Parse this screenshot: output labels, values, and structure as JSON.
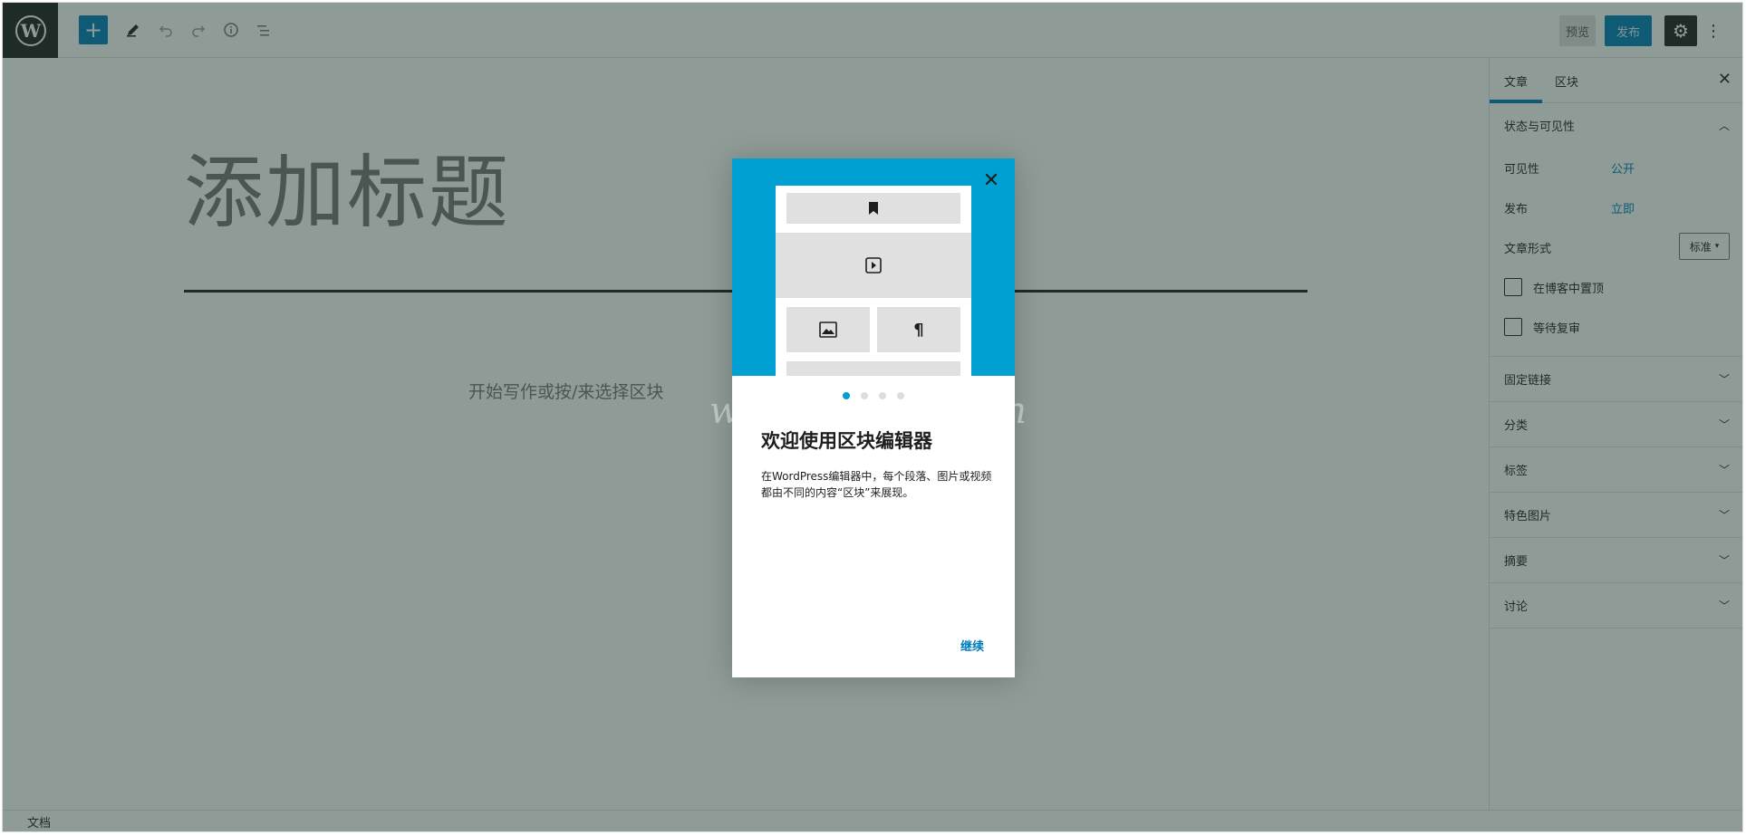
{
  "toolbar": {
    "logo_icon": "wordpress-logo",
    "add_icon": "plus-icon",
    "tools_icon": "pencil-icon",
    "undo_icon": "undo-icon",
    "redo_icon": "redo-icon",
    "info_icon": "info-icon",
    "outline_icon": "list-view-icon",
    "preview_label": "预览",
    "publish_label": "发布",
    "settings_icon": "gear-icon",
    "more_icon": "more-vertical-icon"
  },
  "editor": {
    "title_placeholder": "添加标题",
    "block_placeholder": "开始写作或按/来选择区块"
  },
  "sidebar": {
    "tabs": [
      {
        "label": "文章",
        "active": true
      },
      {
        "label": "区块",
        "active": false
      }
    ],
    "close_icon": "close-icon",
    "status_panel": {
      "title": "状态与可见性",
      "visibility_label": "可见性",
      "visibility_value": "公开",
      "publish_label": "发布",
      "publish_value": "立即",
      "format_label": "文章形式",
      "format_value": "标准",
      "sticky_label": "在博客中置顶",
      "pending_label": "等待复审"
    },
    "panels": [
      {
        "title": "固定链接"
      },
      {
        "title": "分类"
      },
      {
        "title": "标签"
      },
      {
        "title": "特色图片"
      },
      {
        "title": "摘要"
      },
      {
        "title": "讨论"
      }
    ]
  },
  "footer": {
    "breadcrumb": "文档"
  },
  "modal": {
    "heading": "欢迎使用区块编辑器",
    "body": "在WordPress编辑器中，每个段落、图片或视频都由不同的内容“区块”来展现。",
    "continue_label": "继续",
    "page_count": 4,
    "current_page": 1,
    "hero_color": "#00a0d2"
  },
  "watermark": "www.fenonlg.cn",
  "colors": {
    "accent": "#007cba",
    "dark": "#1e1e1e"
  }
}
